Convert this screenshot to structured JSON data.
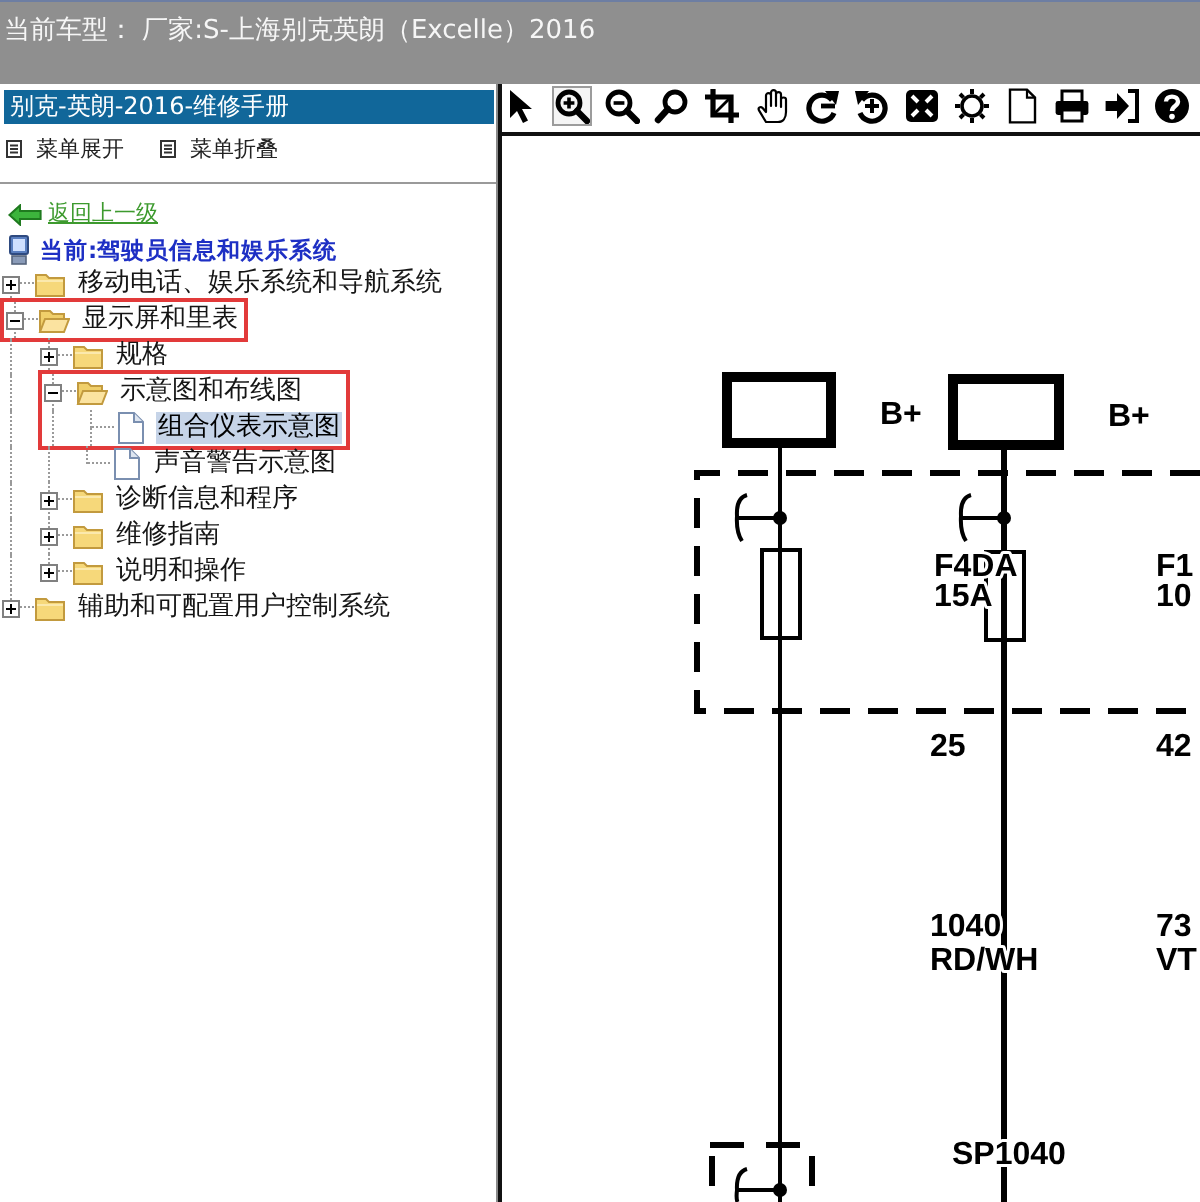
{
  "top_bar": {
    "title": "当前车型： 厂家:S-上海别克英朗（Excelle）2016"
  },
  "sidebar": {
    "header": "别克-英朗-2016-维修手册",
    "menu_actions": [
      {
        "label": "菜单展开"
      },
      {
        "label": "菜单折叠"
      }
    ],
    "back_link": "返回上一级",
    "current": "当前:驾驶员信息和娱乐系统",
    "tree": [
      {
        "label": "移动电话、娱乐系统和导航系统",
        "kind": "folder",
        "expanded": false,
        "selected": false,
        "outlined": false
      },
      {
        "label": "显示屏和里表",
        "kind": "folder",
        "expanded": true,
        "selected": false,
        "outlined": true,
        "children": [
          {
            "label": "规格",
            "kind": "folder",
            "expanded": false,
            "selected": false,
            "outlined": false
          },
          {
            "label": "示意图和布线图",
            "kind": "folder",
            "expanded": true,
            "selected": false,
            "outlined": true,
            "children": [
              {
                "label": "组合仪表示意图",
                "kind": "page",
                "selected": true,
                "outlined": true
              },
              {
                "label": "声音警告示意图",
                "kind": "page",
                "selected": false,
                "outlined": false
              }
            ]
          },
          {
            "label": "诊断信息和程序",
            "kind": "folder",
            "expanded": false,
            "selected": false,
            "outlined": false
          },
          {
            "label": "维修指南",
            "kind": "folder",
            "expanded": false,
            "selected": false,
            "outlined": false
          },
          {
            "label": "说明和操作",
            "kind": "folder",
            "expanded": false,
            "selected": false,
            "outlined": false
          }
        ]
      },
      {
        "label": "辅助和可配置用户控制系统",
        "kind": "folder",
        "expanded": false,
        "selected": false,
        "outlined": false
      }
    ]
  },
  "toolbar": {
    "tools": [
      {
        "kind": "pointer",
        "selected": false
      },
      {
        "kind": "zoom-in",
        "selected": true
      },
      {
        "kind": "zoom-out",
        "selected": false
      },
      {
        "kind": "search",
        "selected": false
      },
      {
        "kind": "crop",
        "selected": false
      },
      {
        "kind": "hand",
        "selected": false
      },
      {
        "kind": "rotate-right",
        "selected": false
      },
      {
        "kind": "rotate-left",
        "selected": false
      },
      {
        "kind": "fit",
        "selected": false
      },
      {
        "kind": "brightness",
        "selected": false
      },
      {
        "kind": "page",
        "selected": false
      },
      {
        "kind": "print",
        "selected": false
      },
      {
        "kind": "exit",
        "selected": false
      },
      {
        "kind": "help",
        "selected": false
      }
    ]
  },
  "diagram": {
    "supply_labels": [
      "B+",
      "B+"
    ],
    "fuses": [
      {
        "name": "F4DA",
        "rating": "15A"
      },
      {
        "name": "F1",
        "rating": "10"
      }
    ],
    "terminals": [
      "25",
      "42"
    ],
    "wires": [
      {
        "circuit": "1040",
        "insulation": "RD/WH"
      },
      {
        "circuit": "73",
        "insulation": "VT"
      }
    ],
    "splice": "SP1040"
  }
}
